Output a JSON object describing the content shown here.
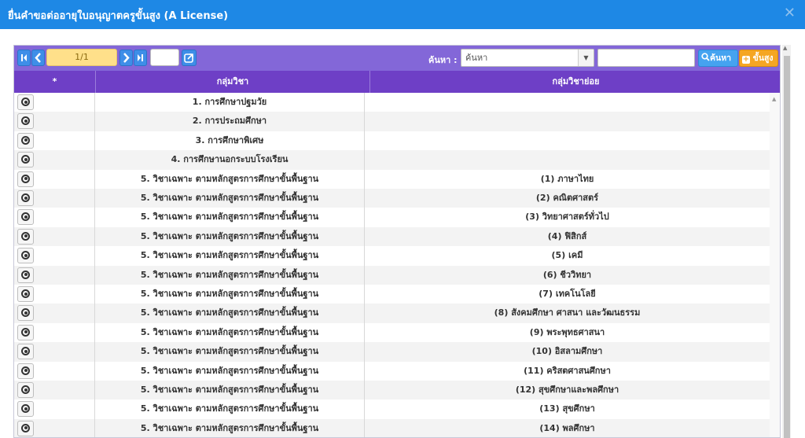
{
  "window": {
    "title": "ยื่นคำขอต่ออายุใบอนุญาตครูขั้นสูง (A License)",
    "close_icon": "close-icon"
  },
  "toolbar": {
    "page_indicator": "1/1",
    "search_label": "ค้นหา :",
    "search_select_placeholder": "ค้นหา",
    "search_button": "ค้นหา",
    "advanced_button": "ขั้นสูง"
  },
  "table": {
    "columns": [
      "*",
      "กลุ่มวิชา",
      "กลุ่มวิชาย่อย"
    ],
    "rows": [
      {
        "group": "1. การศึกษาปฐมวัย",
        "subgroup": ""
      },
      {
        "group": "2. การประถมศึกษา",
        "subgroup": ""
      },
      {
        "group": "3. การศึกษาพิเศษ",
        "subgroup": ""
      },
      {
        "group": "4. การศึกษานอกระบบโรงเรียน",
        "subgroup": ""
      },
      {
        "group": "5. วิชาเฉพาะ ตามหลักสูตรการศึกษาขั้นพื้นฐาน",
        "subgroup": "(1) ภาษาไทย"
      },
      {
        "group": "5. วิชาเฉพาะ ตามหลักสูตรการศึกษาขั้นพื้นฐาน",
        "subgroup": "(2) คณิตศาสตร์"
      },
      {
        "group": "5. วิชาเฉพาะ ตามหลักสูตรการศึกษาขั้นพื้นฐาน",
        "subgroup": "(3) วิทยาศาสตร์ทั่วไป"
      },
      {
        "group": "5. วิชาเฉพาะ ตามหลักสูตรการศึกษาขั้นพื้นฐาน",
        "subgroup": "(4) ฟิสิกส์"
      },
      {
        "group": "5. วิชาเฉพาะ ตามหลักสูตรการศึกษาขั้นพื้นฐาน",
        "subgroup": "(5) เคมี"
      },
      {
        "group": "5. วิชาเฉพาะ ตามหลักสูตรการศึกษาขั้นพื้นฐาน",
        "subgroup": "(6) ชีววิทยา"
      },
      {
        "group": "5. วิชาเฉพาะ ตามหลักสูตรการศึกษาขั้นพื้นฐาน",
        "subgroup": "(7) เทคโนโลยี"
      },
      {
        "group": "5. วิชาเฉพาะ ตามหลักสูตรการศึกษาขั้นพื้นฐาน",
        "subgroup": "(8) สังคมศึกษา ศาสนา และวัฒนธรรม"
      },
      {
        "group": "5. วิชาเฉพาะ ตามหลักสูตรการศึกษาขั้นพื้นฐาน",
        "subgroup": "(9) พระพุทธศาสนา"
      },
      {
        "group": "5. วิชาเฉพาะ ตามหลักสูตรการศึกษาขั้นพื้นฐาน",
        "subgroup": "(10) อิสลามศึกษา"
      },
      {
        "group": "5. วิชาเฉพาะ ตามหลักสูตรการศึกษาขั้นพื้นฐาน",
        "subgroup": "(11) คริสตศาสนศึกษา"
      },
      {
        "group": "5. วิชาเฉพาะ ตามหลักสูตรการศึกษาขั้นพื้นฐาน",
        "subgroup": "(12) สุขศึกษาและพลศึกษา"
      },
      {
        "group": "5. วิชาเฉพาะ ตามหลักสูตรการศึกษาขั้นพื้นฐาน",
        "subgroup": "(13) สุขศึกษา"
      },
      {
        "group": "5. วิชาเฉพาะ ตามหลักสูตรการศึกษาขั้นพื้นฐาน",
        "subgroup": "(14) พลศึกษา"
      }
    ]
  },
  "colors": {
    "titlebar": "#1e88e5",
    "toolbar": "#8367d8",
    "header": "#6e3fc6",
    "pager_input": "#ffe08a",
    "search_button": "#45a3f0",
    "advanced_button": "#f5a623"
  }
}
